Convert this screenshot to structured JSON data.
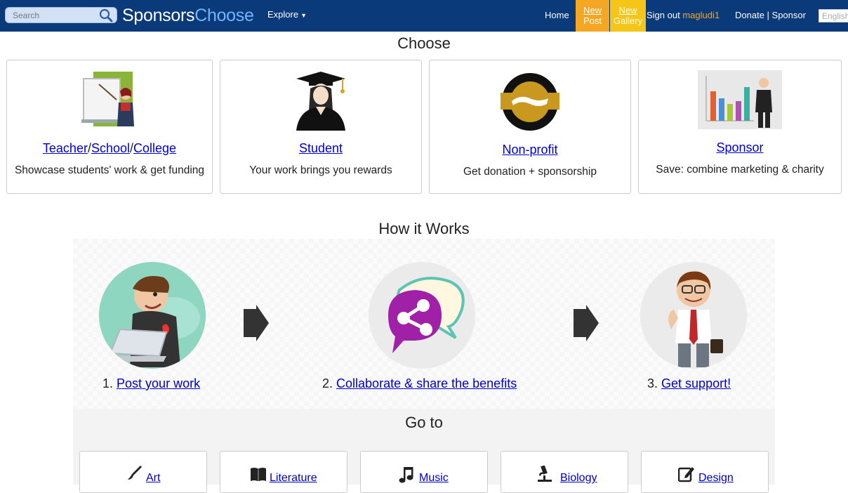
{
  "header": {
    "search_placeholder": "Search",
    "logo_part1": "Sponsors",
    "logo_part2": "Choose",
    "explore": "Explore",
    "home": "Home",
    "new_post": [
      "New",
      "Post"
    ],
    "new_gallery": [
      "New",
      "Gallery"
    ],
    "sign_out": "Sign out",
    "username": "magludi1",
    "donate_sponsor": "Donate | Sponsor",
    "language": "English"
  },
  "choose": {
    "heading": "Choose",
    "cards": [
      {
        "title_parts": [
          "Teacher",
          "/",
          "School",
          "/",
          "College"
        ],
        "desc": "Showcase students' work & get funding",
        "icon": "teacher-icon"
      },
      {
        "title": "Student",
        "desc": "Your work brings you rewards",
        "icon": "graduate-icon"
      },
      {
        "title": "Non-profit",
        "desc": "Get donation + sponsorship",
        "icon": "handshake-icon"
      },
      {
        "title": "Sponsor",
        "desc": "Save: combine marketing & charity",
        "icon": "chart-icon"
      }
    ]
  },
  "how": {
    "heading": "How it Works",
    "steps": [
      {
        "num": "1.",
        "link": "Post your work",
        "icon": "laptop-user-icon"
      },
      {
        "num": "2.",
        "link": "Collaborate & share the benefits",
        "icon": "share-icon"
      },
      {
        "num": "3.",
        "link": "Get support!",
        "icon": "businessman-icon"
      }
    ]
  },
  "goto": {
    "heading": "Go to",
    "items": [
      {
        "label": "Art",
        "icon": "brush-icon"
      },
      {
        "label": "Literature",
        "icon": "book-icon"
      },
      {
        "label": "Music",
        "icon": "music-icon"
      },
      {
        "label": "Biology",
        "icon": "microscope-icon"
      },
      {
        "label": "Design",
        "icon": "design-icon"
      }
    ]
  },
  "colors": {
    "header_bg": "#0a3a7a",
    "new_post_bg": "#f5a623",
    "new_gallery_bg": "#f5c518",
    "link": "#0000cc",
    "username": "#f5a623"
  }
}
